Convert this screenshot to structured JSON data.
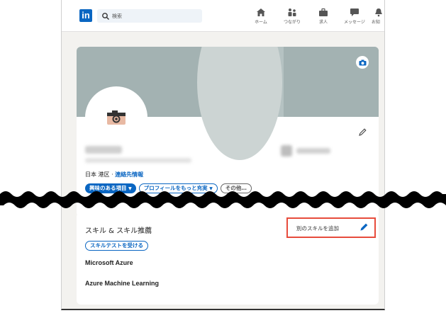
{
  "nav": {
    "logo_text": "in",
    "search_placeholder": "検索",
    "items": [
      {
        "icon": "home-icon",
        "label": "ホーム"
      },
      {
        "icon": "network-icon",
        "label": "つながり"
      },
      {
        "icon": "briefcase-icon",
        "label": "求人"
      },
      {
        "icon": "message-icon",
        "label": "メッセージ"
      },
      {
        "icon": "bell-icon",
        "label": "お知"
      }
    ]
  },
  "profile": {
    "location": "日本 港区",
    "separator": " · ",
    "contact_link": "連絡先情報",
    "buttons": {
      "open_to": "興味のある項目",
      "add_section": "プロフィールをもっと充実",
      "more": "その他…"
    }
  },
  "skills": {
    "title": "スキル & スキル推薦",
    "add_skill": "別のスキルを追加",
    "take_test": "スキルテストを受ける",
    "list": [
      "Microsoft Azure",
      "Azure Machine Learning"
    ]
  },
  "colors": {
    "brand": "#0a66c2",
    "highlight": "#e74c3c",
    "banner": "#a3b2b2"
  }
}
